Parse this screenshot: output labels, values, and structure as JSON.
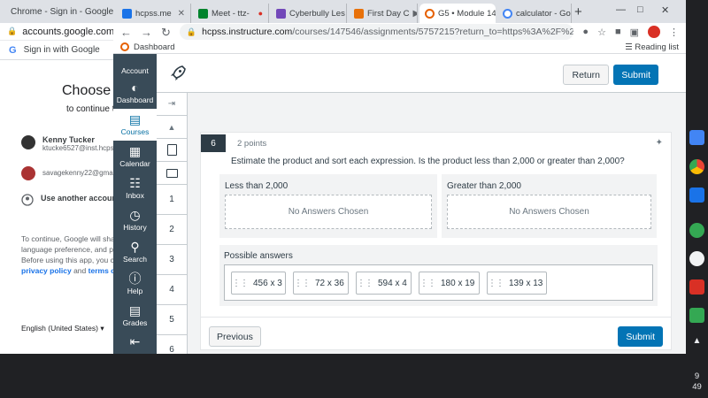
{
  "background_window": {
    "tab_title": "Chrome - Sign in - Google Accounts",
    "url": "accounts.google.com/o/oaut",
    "signin_header": "Sign in with Google",
    "choose": "Choose a",
    "continue": "to continue t",
    "accounts": [
      {
        "name": "Kenny Tucker",
        "email": "ktucke6527@inst.hcpss.o"
      },
      {
        "name": "",
        "email": "savagekenny22@gmail.co"
      }
    ],
    "use_another": "Use another account",
    "paragraph": [
      "To continue, Google will shar",
      "language preference, and pro",
      "Before using this app, you ca"
    ],
    "privacy_policy": "privacy policy",
    "and": "and",
    "terms": "terms of",
    "language": "English (United States)"
  },
  "tabs": [
    {
      "title": "hcpss.me",
      "color": "#1a73e8"
    },
    {
      "title": "Meet - ttz-",
      "color": "#00832d"
    },
    {
      "title": "Cyberbully Les",
      "color": "#7248b9"
    },
    {
      "title": "First Day C",
      "color": "#e8710a"
    },
    {
      "title": "G5 • Module 14",
      "color": "#e66000"
    },
    {
      "title": "calculator - Go",
      "color": "#4285f4"
    }
  ],
  "omnibox": {
    "host": "hcpss.instructure.com",
    "path": "/courses/147546/assignments/5757215?return_to=https%3A%2F%2Fhcpss.ins..."
  },
  "bookmarks": {
    "item": "Dashboard",
    "reading_list": "Reading list"
  },
  "global_nav": [
    {
      "label": "Account",
      "icon": "account-icon"
    },
    {
      "label": "Dashboard",
      "icon": "dashboard-icon"
    },
    {
      "label": "Courses",
      "icon": "courses-icon",
      "active": true
    },
    {
      "label": "Calendar",
      "icon": "calendar-icon"
    },
    {
      "label": "Inbox",
      "icon": "inbox-icon"
    },
    {
      "label": "History",
      "icon": "history-icon"
    },
    {
      "label": "Search",
      "icon": "search-icon"
    },
    {
      "label": "Help",
      "icon": "help-icon"
    },
    {
      "label": "Grades",
      "icon": "grades-icon"
    }
  ],
  "topbar": {
    "return": "Return",
    "submit": "Submit"
  },
  "question_nav": [
    "1",
    "2",
    "3",
    "4",
    "5",
    "6"
  ],
  "question": {
    "number": "6",
    "points": "2 points",
    "text": "Estimate the product and sort each expression. Is the product less than 2,000 or greater than 2,000?",
    "categories": [
      {
        "label": "Less than 2,000",
        "empty": "No Answers Chosen"
      },
      {
        "label": "Greater than 2,000",
        "empty": "No Answers Chosen"
      }
    ],
    "possible_label": "Possible answers",
    "answers": [
      "456 x 3",
      "72 x 36",
      "594 x 4",
      "180 x 19",
      "139 x 13"
    ],
    "previous": "Previous",
    "submit": "Submit"
  },
  "shelf": {
    "time_hour": "9",
    "time_min": "49"
  },
  "colors": {
    "canvas_nav": "#394b58",
    "primary": "#0374b5",
    "chrome_tabbar": "#dee1e6"
  }
}
